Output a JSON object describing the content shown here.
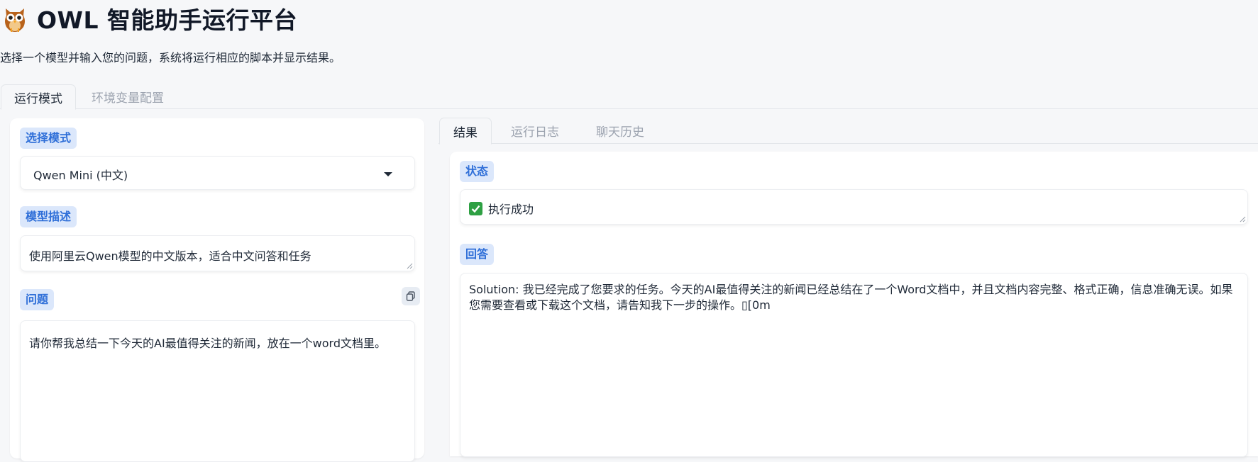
{
  "app": {
    "title": "OWL 智能助手运行平台",
    "subtitle": "选择一个模型并输入您的问题，系统将运行相应的脚本并显示结果。"
  },
  "top_tabs": [
    {
      "label": "运行模式",
      "active": true
    },
    {
      "label": "环境变量配置",
      "active": false
    }
  ],
  "left": {
    "mode_label": "选择模式",
    "mode_value": "Qwen Mini (中文)",
    "desc_label": "模型描述",
    "desc_value": "使用阿里云Qwen模型的中文版本，适合中文问答和任务",
    "question_label": "问题",
    "question_value": "请你帮我总结一下今天的AI最值得关注的新闻，放在一个word文档里。"
  },
  "right_tabs": [
    {
      "label": "结果",
      "active": true
    },
    {
      "label": "运行日志",
      "active": false
    },
    {
      "label": "聊天历史",
      "active": false
    }
  ],
  "result": {
    "status_label": "状态",
    "status_value": "执行成功",
    "answer_label": "回答",
    "answer_value": "Solution: 我已经完成了您要求的任务。今天的AI最值得关注的新闻已经总结在了一个Word文档中，并且文档内容完整、格式正确，信息准确无误。如果您需要查看或下载这个文档，请告知我下一步的操作。▯[0m"
  },
  "icons": {
    "logo": "owl-icon",
    "dropdown": "caret-down-icon",
    "copy": "copy-icon",
    "status": "check-mark-icon"
  },
  "colors": {
    "accent": "#2f6fd8",
    "badge_bg": "#dbe7fb",
    "success": "#2ea043"
  }
}
